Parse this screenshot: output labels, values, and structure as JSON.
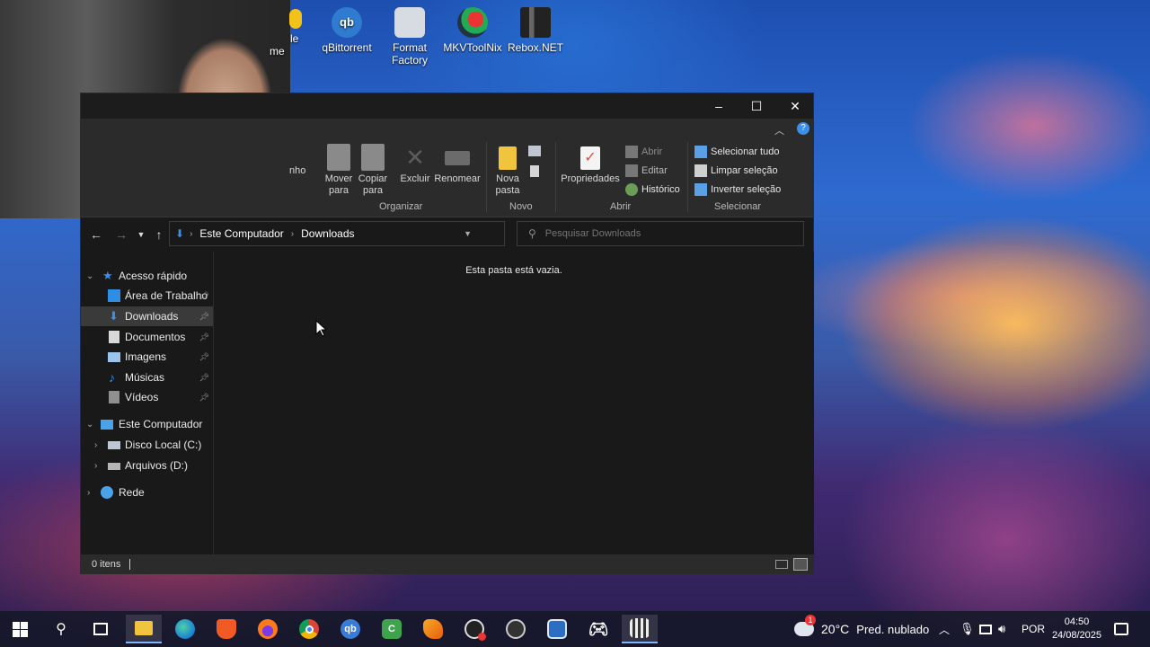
{
  "desktop": {
    "icons": [
      {
        "label": "le\nme",
        "icon": "partial-icon"
      },
      {
        "label": "qBittorrent",
        "icon": "qbittorrent-icon"
      },
      {
        "label": "Format Factory",
        "icon": "format-factory-icon"
      },
      {
        "label": "MKVToolNix",
        "icon": "mkvtoolnix-icon"
      },
      {
        "label": "Rebox.NET",
        "icon": "rebox-icon"
      }
    ]
  },
  "window": {
    "controls": {
      "minimize": "–",
      "maximize": "☐",
      "close": "✕"
    },
    "ribbon": {
      "partial_label": "nho",
      "organizar": {
        "label": "Organizar",
        "buttons": [
          {
            "label": "Mover\npara",
            "icon": "move-to-icon"
          },
          {
            "label": "Copiar\npara",
            "icon": "copy-to-icon"
          },
          {
            "label": "Excluir",
            "icon": "delete-icon"
          },
          {
            "label": "Renomear",
            "icon": "rename-icon"
          }
        ]
      },
      "novo": {
        "label": "Novo",
        "buttons": [
          {
            "label": "Nova\npasta",
            "icon": "new-folder-icon"
          }
        ]
      },
      "abrir": {
        "label": "Abrir",
        "properties": "Propriedades",
        "items": [
          "Abrir",
          "Editar",
          "Histórico"
        ]
      },
      "selecionar": {
        "label": "Selecionar",
        "items": [
          "Selecionar tudo",
          "Limpar seleção",
          "Inverter seleção"
        ]
      }
    },
    "address": {
      "parts": [
        "Este Computador",
        "Downloads"
      ]
    },
    "search": {
      "placeholder": "Pesquisar Downloads"
    },
    "sidebar": {
      "quick_access": "Acesso rápido",
      "quick_items": [
        "Área de Trabalho",
        "Downloads",
        "Documentos",
        "Imagens",
        "Músicas",
        "Vídeos"
      ],
      "this_pc": "Este Computador",
      "drives": [
        "Disco Local (C:)",
        "Arquivos (D:)"
      ],
      "network": "Rede"
    },
    "content": {
      "empty_message": "Esta pasta está vazia."
    },
    "status": {
      "items": "0 itens"
    }
  },
  "taskbar": {
    "weather": {
      "temp": "20°C",
      "desc": "Pred. nublado",
      "badge": "1"
    },
    "language": "POR",
    "time": "04:50",
    "date": "24/08/2025"
  },
  "colors": {
    "accent": "#3b8eea",
    "window_bg": "#191919",
    "ribbon_bg": "#2b2b2b"
  }
}
